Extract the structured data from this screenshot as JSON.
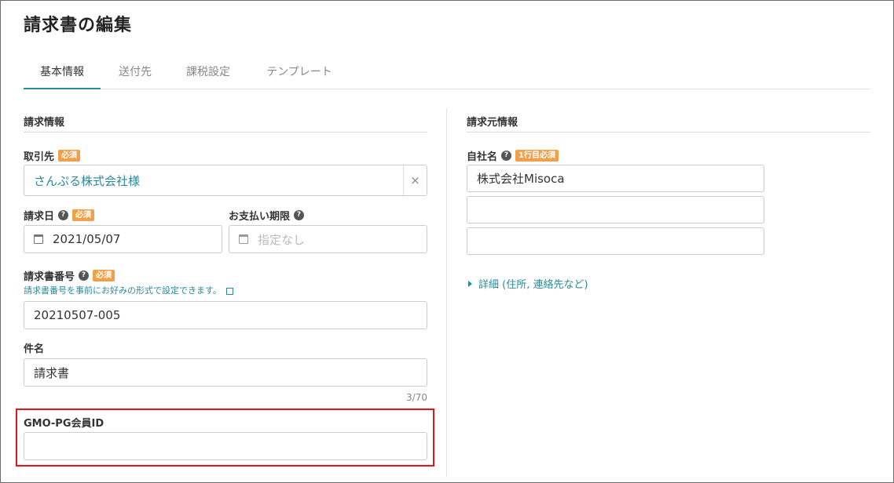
{
  "page": {
    "title": "請求書の編集"
  },
  "tabs": [
    {
      "label": "基本情報",
      "active": true
    },
    {
      "label": "送付先",
      "active": false
    },
    {
      "label": "課税設定",
      "active": false
    },
    {
      "label": "テンプレート",
      "active": false
    }
  ],
  "billing_info": {
    "section_title": "請求情報",
    "client": {
      "label": "取引先",
      "badge": "必須",
      "value": "さんぷる株式会社様",
      "clear": "×"
    },
    "invoice_date": {
      "label": "請求日",
      "help": "?",
      "badge": "必須",
      "value": "2021/05/07"
    },
    "due_date": {
      "label": "お支払い期限",
      "help": "?",
      "placeholder": "指定なし"
    },
    "invoice_number": {
      "label": "請求書番号",
      "help": "?",
      "badge": "必須",
      "hint": "請求書番号を事前にお好みの形式で設定できます。",
      "value": "20210507-005"
    },
    "subject": {
      "label": "件名",
      "value": "請求書",
      "counter": "3/70"
    },
    "gmo_member_id": {
      "label": "GMO-PG会員ID",
      "value": ""
    }
  },
  "issuer_info": {
    "section_title": "請求元情報",
    "company_name": {
      "label": "自社名",
      "help": "?",
      "badge": "1行目必須",
      "lines": [
        "株式会社Misoca",
        "",
        ""
      ]
    },
    "details_link": "詳細 (住所, 連絡先など)"
  },
  "colors": {
    "accent": "#2a8a9a",
    "badge": "#f0a04b",
    "highlight": "#e8141c"
  }
}
